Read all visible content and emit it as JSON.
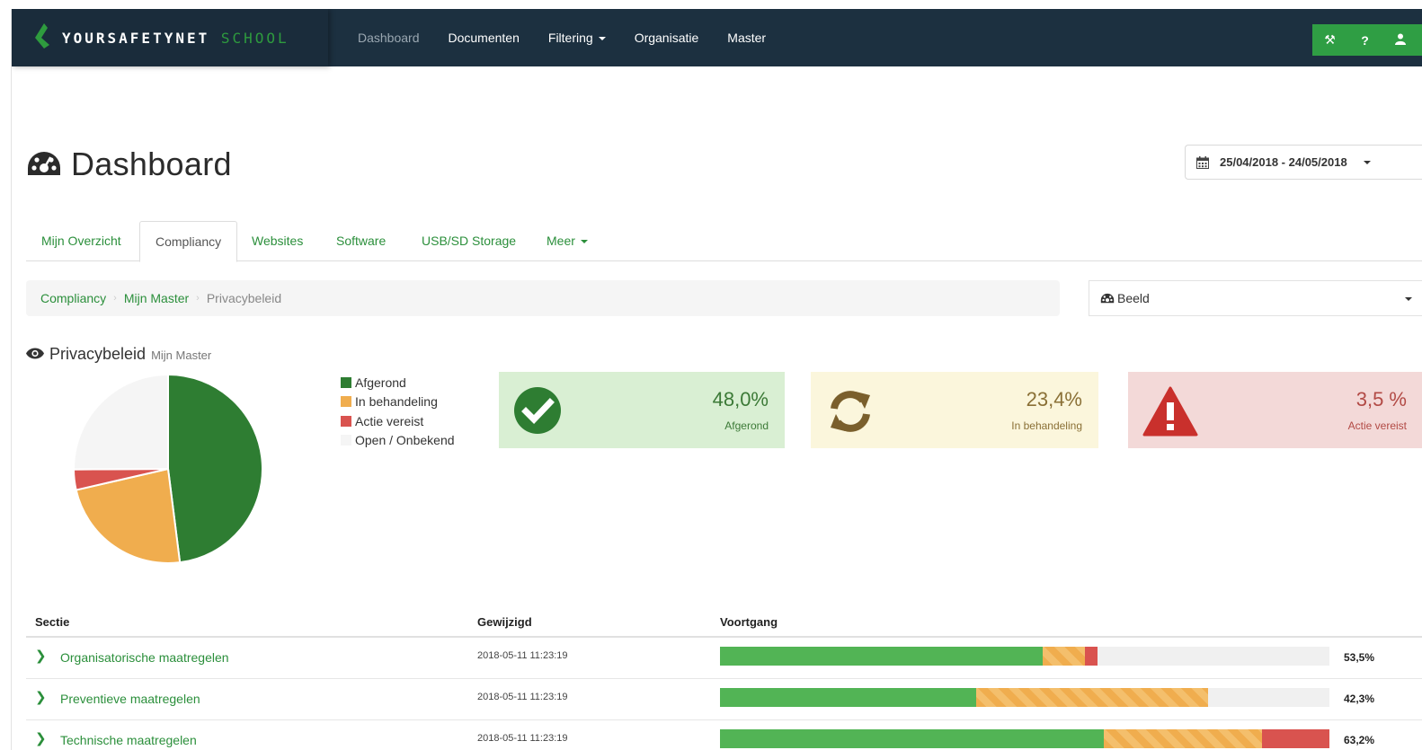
{
  "brand": {
    "main": "YOURSAFETYNET",
    "sub": "SCHOOL"
  },
  "nav": {
    "links": [
      "Dashboard",
      "Documenten",
      "Filtering",
      "Organisatie",
      "Master"
    ],
    "actions": [
      "wrench-icon",
      "help-icon",
      "user-icon"
    ],
    "action_glyphs": [
      "⚒",
      "?",
      "👤"
    ]
  },
  "page": {
    "title": "Dashboard"
  },
  "date_range": "25/04/2018 - 24/05/2018",
  "tabs": [
    "Mijn Overzicht",
    "Compliancy",
    "Websites",
    "Software",
    "USB/SD Storage",
    "Meer"
  ],
  "breadcrumb": {
    "items": [
      "Compliancy",
      "Mijn Master"
    ],
    "current": "Privacybeleid"
  },
  "view_select": {
    "label": "Beeld"
  },
  "section": {
    "title": "Privacybeleid",
    "subtitle": "Mijn Master"
  },
  "colors": {
    "green": "#2e7d32",
    "orange": "#f0ad4e",
    "red": "#d9534f",
    "unknown": "#f5f5f5",
    "brand_green": "#2f9e44",
    "navbar": "#1c3040"
  },
  "chart_data": {
    "type": "pie",
    "series": [
      {
        "name": "Afgerond",
        "value": 48.0,
        "color": "#2e7d32"
      },
      {
        "name": "In behandeling",
        "value": 23.4,
        "color": "#f0ad4e"
      },
      {
        "name": "Actie vereist",
        "value": 3.5,
        "color": "#d9534f"
      },
      {
        "name": "Open / Onbekend",
        "value": 25.1,
        "color": "#f5f5f5"
      }
    ]
  },
  "legend": [
    "Afgerond",
    "In behandeling",
    "Actie vereist",
    "Open / Onbekend"
  ],
  "stats": [
    {
      "value": "48,0%",
      "label": "Afgerond"
    },
    {
      "value": "23,4%",
      "label": "In behandeling"
    },
    {
      "value": "3,5 %",
      "label": "Actie vereist"
    }
  ],
  "table": {
    "headers": [
      "Sectie",
      "Gewijzigd",
      "Voortgang"
    ],
    "rows": [
      {
        "section": "Organisatorische maatregelen",
        "modified": "2018-05-11 11:23:19",
        "percent": "53,5%",
        "green": 53,
        "orange": 7,
        "red": 2
      },
      {
        "section": "Preventieve maatregelen",
        "modified": "2018-05-11 11:23:19",
        "percent": "42,3%",
        "green": 42,
        "orange": 38,
        "red": 0
      },
      {
        "section": "Technische maatregelen",
        "modified": "2018-05-11 11:23:19",
        "percent": "63,2%",
        "green": 63,
        "orange": 26,
        "red": 11
      }
    ]
  }
}
